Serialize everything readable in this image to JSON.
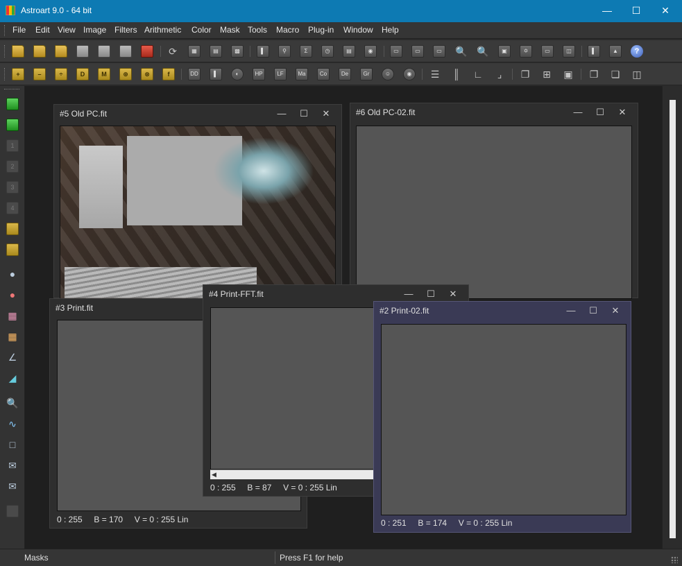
{
  "window": {
    "title": "Astroart 9.0 - 64 bit"
  },
  "menu": [
    "File",
    "Edit",
    "View",
    "Image",
    "Filters",
    "Arithmetic",
    "Color",
    "Mask",
    "Tools",
    "Macro",
    "Plug-in",
    "Window",
    "Help"
  ],
  "toolbar2_labels": [
    "DD",
    "HP",
    "LF",
    "Ma",
    "Co",
    "De",
    "Gr"
  ],
  "left_toolbar_numbers": [
    "1",
    "2",
    "3",
    "4"
  ],
  "windows": {
    "w5": {
      "title": "#5 Old PC.fit"
    },
    "w6": {
      "title": "#6 Old PC-02.fit"
    },
    "w3": {
      "title": "#3 Print.fit",
      "status": "0 : 255     B = 170     V = 0 : 255 Lin"
    },
    "w4": {
      "title": "#4 Print-FFT.fit",
      "status": "0 : 255     B = 87     V = 0 : 255 Lin"
    },
    "w2": {
      "title": "#2 Print-02.fit",
      "status": "0 : 251     B = 174     V = 0 : 255 Lin"
    }
  },
  "status": {
    "left": "Masks",
    "right": "Press F1 for help"
  },
  "colors": {
    "titlebar": "#0d7ab3",
    "active_window": "#3a3a55"
  }
}
